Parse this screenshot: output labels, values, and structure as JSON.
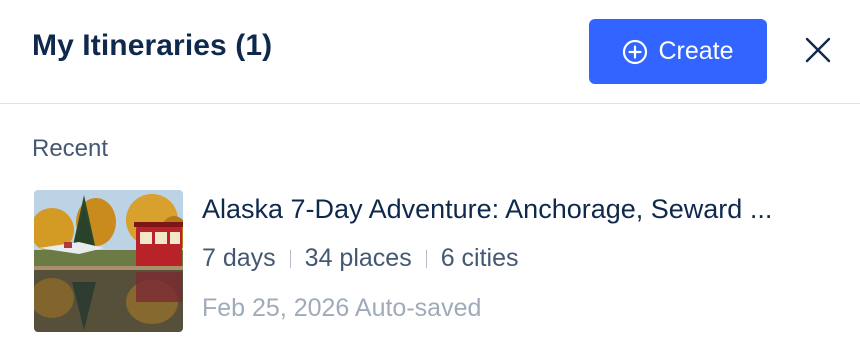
{
  "header": {
    "title": "My Itineraries (1)",
    "create_label": "Create",
    "create_icon": "plus-circle-icon",
    "close_icon": "close-icon"
  },
  "recent": {
    "label": "Recent",
    "items": [
      {
        "title": "Alaska 7-Day Adventure: Anchorage, Seward ...",
        "days": "7 days",
        "places": "34 places",
        "cities": "6 cities",
        "saved": "Feb 25, 2026 Auto-saved"
      }
    ]
  },
  "colors": {
    "accent": "#3264ff",
    "title": "#0f294d",
    "secondary": "#455873",
    "muted": "#a0abba"
  }
}
